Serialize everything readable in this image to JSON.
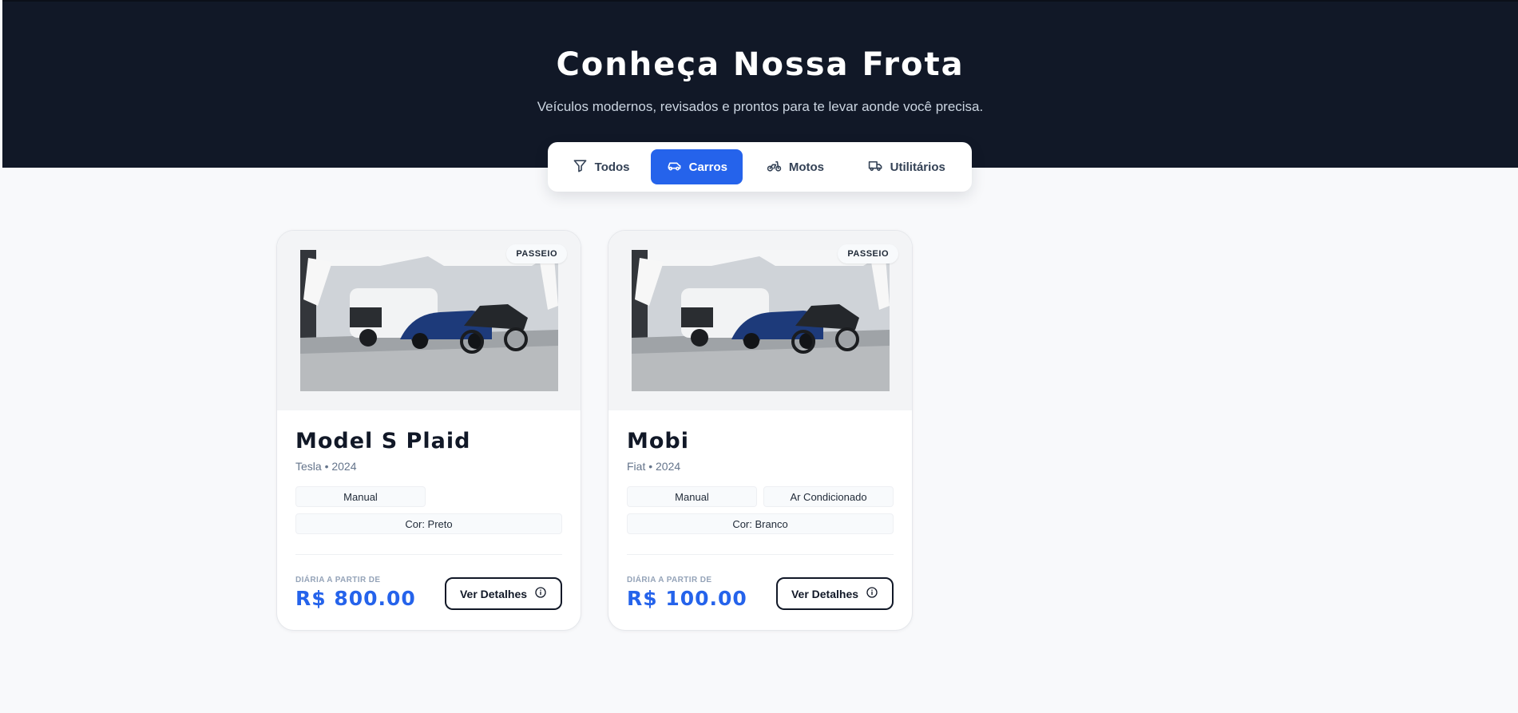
{
  "hero": {
    "title": "Conheça Nossa Frota",
    "subtitle": "Veículos modernos, revisados e prontos para te levar aonde você precisa."
  },
  "filters": [
    {
      "label": "Todos",
      "icon": "filter-icon",
      "active": false
    },
    {
      "label": "Carros",
      "icon": "car-icon",
      "active": true
    },
    {
      "label": "Motos",
      "icon": "bike-icon",
      "active": false
    },
    {
      "label": "Utilitários",
      "icon": "truck-icon",
      "active": false
    }
  ],
  "vehicles": [
    {
      "name": "Model S Plaid",
      "meta": "Tesla • 2024",
      "badge": "PASSEIO",
      "features": [
        "Manual",
        "Cor: Preto"
      ],
      "price_label": "DIÁRIA A PARTIR DE",
      "price": "R$ 800.00",
      "details_label": "Ver Detalhes"
    },
    {
      "name": "Mobi",
      "meta": "Fiat • 2024",
      "badge": "PASSEIO",
      "features": [
        "Manual",
        "Ar Condicionado",
        "Cor: Branco"
      ],
      "price_label": "DIÁRIA A PARTIR DE",
      "price": "R$ 100.00",
      "details_label": "Ver Detalhes"
    }
  ],
  "colors": {
    "hero_bg": "#111827",
    "accent": "#2563eb",
    "page_bg": "#f8f9fb"
  }
}
